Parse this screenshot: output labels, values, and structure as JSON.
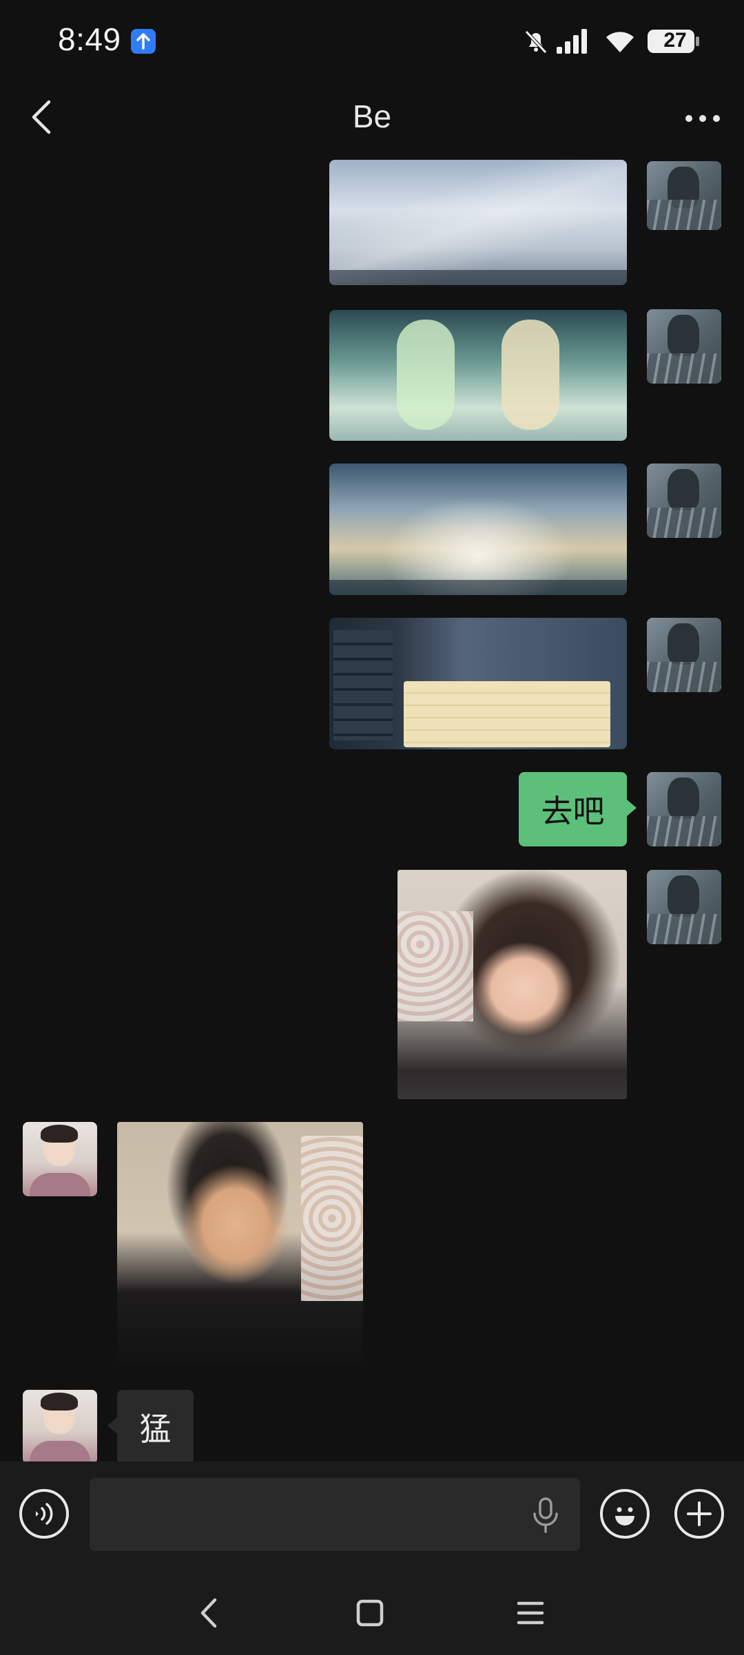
{
  "status_bar": {
    "time": "8:49",
    "battery": "27",
    "icons": [
      "location-upload-icon",
      "mute-bell-icon",
      "signal-icon",
      "wifi-icon",
      "battery-icon"
    ]
  },
  "header": {
    "title": "Be",
    "back_icon": "chevron-left-icon",
    "more_icon": "more-dots-icon"
  },
  "messages": [
    {
      "from": "me",
      "type": "image",
      "content": "game-screenshot"
    },
    {
      "from": "me",
      "type": "image",
      "content": "game-screenshot"
    },
    {
      "from": "me",
      "type": "image",
      "content": "game-screenshot"
    },
    {
      "from": "me",
      "type": "image",
      "content": "game-screenshot"
    },
    {
      "from": "me",
      "type": "text",
      "text": "去吧"
    },
    {
      "from": "me",
      "type": "sticker",
      "content": "girl-sticker"
    },
    {
      "from": "friend",
      "type": "sticker",
      "content": "man-sticker"
    },
    {
      "from": "friend",
      "type": "text",
      "text": "猛"
    }
  ],
  "input_bar": {
    "value": "",
    "placeholder": "",
    "icons": [
      "voice-icon",
      "microphone-icon",
      "emoji-icon",
      "plus-icon"
    ]
  },
  "nav_bar": {
    "icons": [
      "nav-back-icon",
      "nav-home-icon",
      "nav-menu-icon"
    ]
  },
  "colors": {
    "background": "#111111",
    "my_bubble": "#5cbf7a",
    "friend_bubble": "#2a2a2a",
    "location_badge": "#2f7cf6"
  }
}
